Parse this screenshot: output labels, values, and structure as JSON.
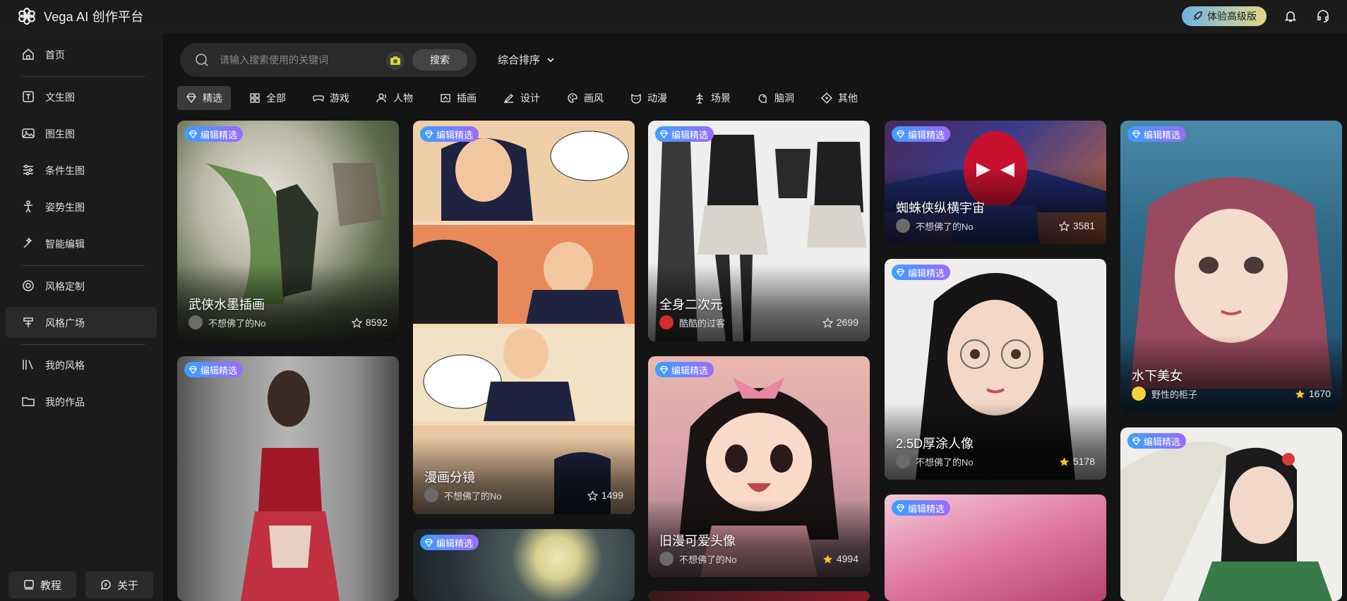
{
  "app": {
    "title": "Vega AI 创作平台"
  },
  "header": {
    "upgrade_label": "体验高级版"
  },
  "sidebar": {
    "items": [
      {
        "label": "首页",
        "icon": "home-icon"
      },
      {
        "label": "文生图",
        "icon": "text-image-icon"
      },
      {
        "label": "图生图",
        "icon": "image-icon"
      },
      {
        "label": "条件生图",
        "icon": "sliders-icon"
      },
      {
        "label": "姿势生图",
        "icon": "pose-icon"
      },
      {
        "label": "智能编辑",
        "icon": "magic-edit-icon"
      },
      {
        "label": "风格定制",
        "icon": "style-custom-icon"
      },
      {
        "label": "风格广场",
        "icon": "style-square-icon"
      },
      {
        "label": "我的风格",
        "icon": "my-style-icon"
      },
      {
        "label": "我的作品",
        "icon": "folder-icon"
      }
    ],
    "active": "风格广场",
    "bottom": {
      "tutorial": "教程",
      "about": "关于"
    }
  },
  "search": {
    "placeholder": "请输入搜索使用的关键词",
    "button": "搜索",
    "value": ""
  },
  "sort": {
    "label": "综合排序"
  },
  "tabs": [
    "精选",
    "全部",
    "游戏",
    "人物",
    "插画",
    "设计",
    "画风",
    "动漫",
    "场景",
    "脑洞",
    "其他"
  ],
  "active_tab": "精选",
  "badge_label": "编辑精选",
  "cards": [
    {
      "title": "武侠水墨插画",
      "author": "不想佛了的No",
      "likes": "8592"
    },
    {
      "title": "",
      "author": "",
      "likes": ""
    },
    {
      "title": "漫画分镜",
      "author": "不想佛了的No",
      "likes": "1499"
    },
    {
      "title": "",
      "author": "",
      "likes": ""
    },
    {
      "title": "全身二次元",
      "author": "酷酷的过客",
      "likes": "2699"
    },
    {
      "title": "旧漫可爱头像",
      "author": "不想佛了的No",
      "likes": "4994"
    },
    {
      "title": "",
      "author": "",
      "likes": ""
    },
    {
      "title": "蜘蛛侠纵横宇宙",
      "author": "不想佛了的No",
      "likes": "3581"
    },
    {
      "title": "2.5D厚涂人像",
      "author": "不想佛了的No",
      "likes": "5178"
    },
    {
      "title": "",
      "author": "",
      "likes": ""
    },
    {
      "title": "水下美女",
      "author": "野性的柜子",
      "likes": "1670"
    },
    {
      "title": "",
      "author": "",
      "likes": ""
    }
  ],
  "colors": {
    "accent_badge_start": "#3aa0ff",
    "accent_badge_end": "#9a6bff",
    "star_gold": "#f5c518",
    "bg": "#141414"
  }
}
